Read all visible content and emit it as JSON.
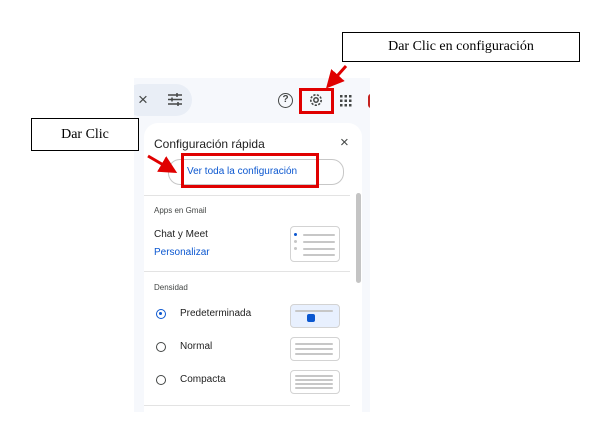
{
  "annotations": {
    "callout_settings": "Dar Clic en configuración",
    "callout_click": "Dar Clic",
    "highlight_color": "#e00000"
  },
  "toolbar": {
    "close_icon": "×",
    "filter_icon": "filter-sliders-icon",
    "help_icon": "?",
    "settings_icon": "gear-icon",
    "apps_icon": "apps-grid-icon"
  },
  "quick_settings": {
    "title": "Configuración rápida",
    "close": "×",
    "see_all": "Ver toda la configuración",
    "apps_section": "Apps en Gmail",
    "chat_meet": "Chat y Meet",
    "customize": "Personalizar",
    "density_section": "Densidad",
    "options": [
      "Predeterminada",
      "Normal",
      "Compacta"
    ],
    "selected_option": "Predeterminada"
  }
}
